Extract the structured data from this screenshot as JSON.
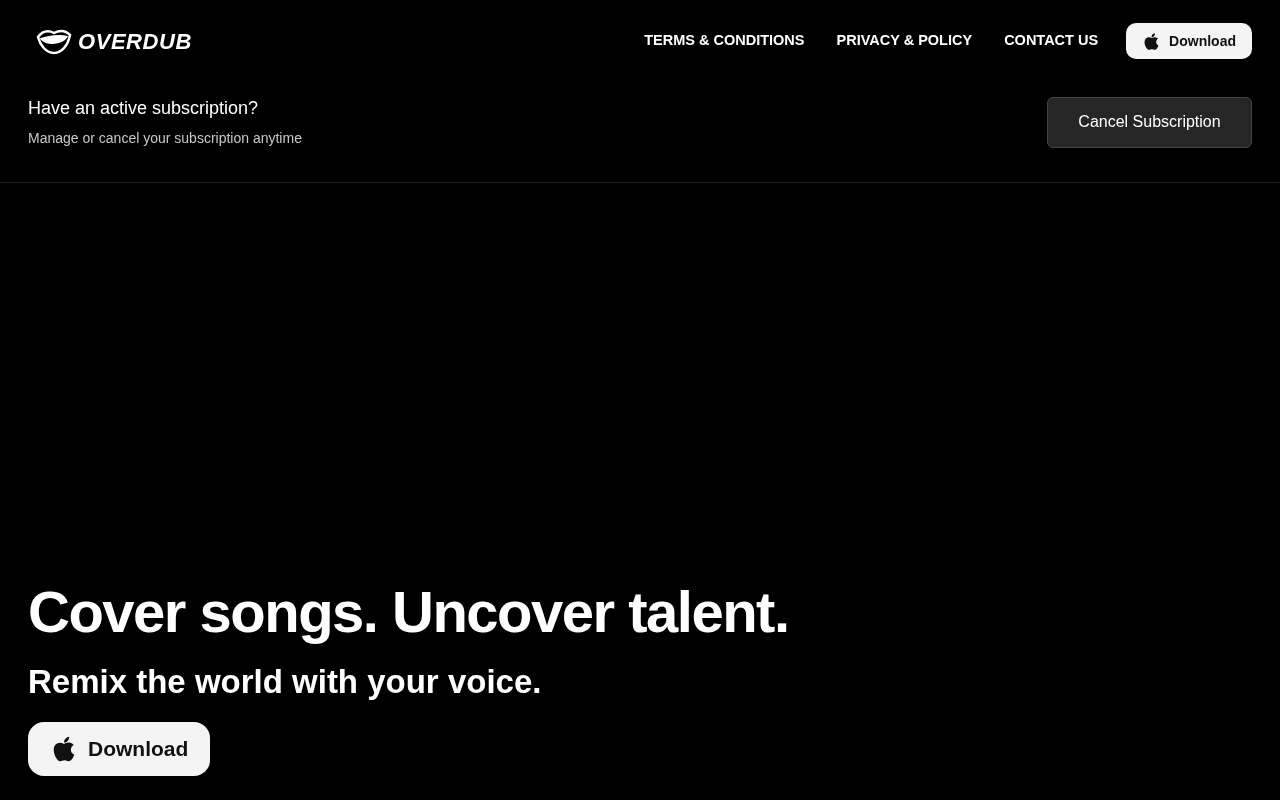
{
  "header": {
    "logo_text": "OVERDUB",
    "nav": [
      {
        "label": "TERMS & CONDITIONS"
      },
      {
        "label": "PRIVACY & POLICY"
      },
      {
        "label": "CONTACT US"
      }
    ],
    "download_button": "Download"
  },
  "subscription": {
    "title": "Have an active subscription?",
    "subtitle": "Manage or cancel your subscription anytime",
    "button": "Cancel Subscription"
  },
  "hero": {
    "headline": "Cover songs. Uncover talent.",
    "tagline": "Remix the world with your voice.",
    "download_button": "Download"
  }
}
